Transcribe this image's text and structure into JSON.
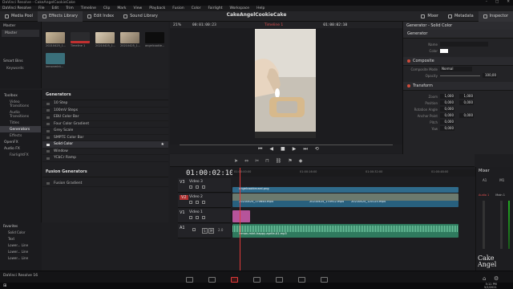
{
  "window": {
    "app_title": "DaVinci Resolve - CakeAngelCookieCake"
  },
  "menu": [
    "DaVinci Resolve",
    "File",
    "Edit",
    "Trim",
    "Timeline",
    "Clip",
    "Mark",
    "View",
    "Playback",
    "Fusion",
    "Color",
    "Fairlight",
    "Workspace",
    "Help"
  ],
  "toolbar": {
    "media_pool": "Media Pool",
    "effects_library": "Effects Library",
    "edit_index": "Edit Index",
    "sound_library": "Sound Library",
    "project_title": "CakeAngelCookieCake",
    "mixer": "Mixer",
    "metadata": "Metadata",
    "inspector": "Inspector"
  },
  "media_pool": {
    "master": "Master",
    "bins_master": "Master",
    "smart_bins": "Smart Bins",
    "keywords": "Keywords",
    "clips": [
      "20210425_1...",
      "Timeline 1",
      "20210425_1...",
      "20210425_1...",
      "angelcookie...",
      "lemonmint..."
    ]
  },
  "toolbox": {
    "root": "Toolbox",
    "items": [
      "Video Transitions",
      "Audio Transitions",
      "Titles",
      "Generators",
      "Effects"
    ],
    "selected": "Generators",
    "openfx": "OpenFX",
    "audiofx": "Audio FX",
    "fairlightfx": "FairlightFX"
  },
  "generators": {
    "header": "Generators",
    "items": [
      "10 Step",
      "100mV Steps",
      "EBU Color Bar",
      "Four Color Gradient",
      "Grey Scale",
      "SMPTE Color Bar",
      "Solid Color",
      "Window",
      "YCbCr Ramp"
    ],
    "selected": "Solid Color",
    "fusion_header": "Fusion Generators",
    "fusion_items": [
      "Fusion Gradient"
    ]
  },
  "favorites": {
    "header": "Favorites",
    "items": [
      "Solid Color",
      "Text",
      "Lower... Line",
      "Lower... Line",
      "Lower... Line"
    ]
  },
  "viewer": {
    "zoom": "21%",
    "src_tc": "00:01:00:23",
    "timeline_name": "Timeline 1",
    "tc": "01:00:02:10"
  },
  "timeline": {
    "timecode": "01:00:02:10",
    "ruler": [
      "01:00:00:00",
      "01:00:16:00",
      "01:00:32:00",
      "01:00:48:00"
    ],
    "tracks": [
      {
        "id": "V3",
        "name": "Video 3"
      },
      {
        "id": "V2",
        "name": "Video 2"
      },
      {
        "id": "V1",
        "name": "Video 1"
      },
      {
        "id": "A1",
        "name": "",
        "level": "2.0"
      }
    ],
    "clips": {
      "v3": "angelcookiecard.png",
      "v2_a": "20210425_170644.mp4",
      "v2_b": "20210425_170912.mp4",
      "v2_c": "20210425_120125.mp4",
      "a1": "lemon-mint-happy-aprile-A1.mp3"
    }
  },
  "inspector": {
    "title": "Generator - Solid Color",
    "generator": "Generator",
    "name_label": "Name",
    "color_label": "Color",
    "composite": "Composite",
    "composite_mode_label": "Composite Mode",
    "composite_mode": "Normal",
    "opacity_label": "Opacity",
    "opacity": "100,00",
    "transform": "Transform",
    "zoom_label": "Zoom",
    "zoom_x": "1,000",
    "zoom_y": "1,000",
    "position_label": "Position",
    "position_x": "0,000",
    "position_y": "0,000",
    "rotation_label": "Rotation Angle",
    "rotation": "0,000",
    "anchor_label": "Anchor Point",
    "anchor_x": "0,000",
    "anchor_y": "0,000",
    "pitch_label": "Pitch",
    "pitch": "0,000",
    "yaw_label": "Yaw",
    "yaw": "0,000"
  },
  "mixer": {
    "title": "Mixer",
    "ch1": "A1",
    "ch2": "M1",
    "audio1": "Audio 1",
    "main1": "Main 1"
  },
  "bottom": {
    "app": "DaVinci Resolve 16"
  },
  "taskbar": {
    "time": "5:11 PM",
    "date": "5/2/2021"
  },
  "watermark": "Cake Angel",
  "colors": {
    "accent": "#e03a3a",
    "video_clip": "#2f6b8c",
    "audio_clip": "#2f7a5e",
    "generator_clip": "#b6549a"
  }
}
